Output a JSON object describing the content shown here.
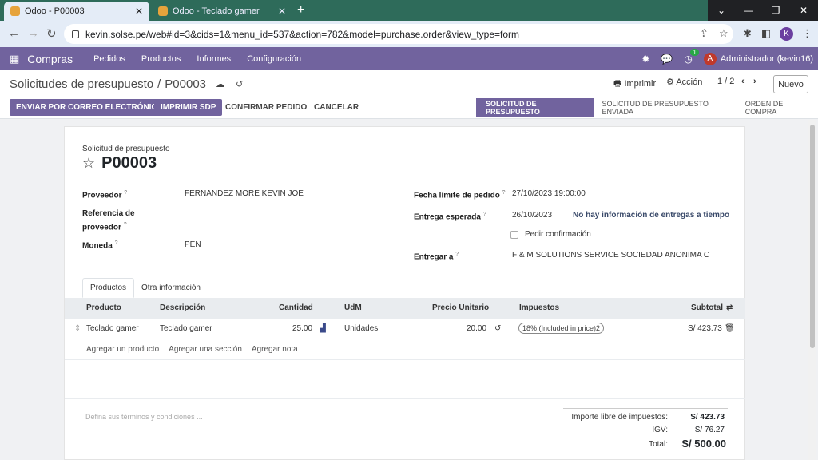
{
  "browser": {
    "tabs": [
      {
        "title": "Odoo - P00003",
        "active": true
      },
      {
        "title": "Odoo - Teclado gamer",
        "active": false
      }
    ],
    "url": "kevin.solse.pe/web#id=3&cids=1&menu_id=537&action=782&model=purchase.order&view_type=form",
    "profile_initial": "K"
  },
  "navbar": {
    "app_name": "Compras",
    "menus": [
      "Pedidos",
      "Productos",
      "Informes",
      "Configuración"
    ],
    "activity_count": "1",
    "user_initial": "A",
    "user_name": "Administrador (kevin16)"
  },
  "control_panel": {
    "breadcrumb_parent": "Solicitudes de presupuesto",
    "breadcrumb_sep": "/",
    "breadcrumb_current": "P00003",
    "print_label": "Imprimir",
    "action_label": "Acción",
    "pager": "1 / 2",
    "new_label": "Nuevo",
    "buttons": {
      "send_email": "ENVIAR POR CORREO ELECTRÓNICO",
      "print_rfq": "IMPRIMIR SDP",
      "confirm": "CONFIRMAR PEDIDO",
      "cancel": "CANCELAR"
    },
    "stages": [
      "SOLICITUD DE PRESUPUESTO",
      "SOLICITUD DE PRESUPUESTO ENVIADA",
      "ORDEN DE COMPRA"
    ]
  },
  "form": {
    "doc_label": "Solicitud de presupuesto",
    "name": "P00003",
    "fields": {
      "vendor_label": "Proveedor",
      "vendor": "FERNANDEZ MORE KEVIN JOE",
      "vendor_ref_label_1": "Referencia de",
      "vendor_ref_label_2": "proveedor",
      "currency_label": "Moneda",
      "currency": "PEN",
      "deadline_label": "Fecha límite de pedido",
      "deadline": "27/10/2023 19:00:00",
      "expected_label": "Entrega esperada",
      "expected": "26/10/2023",
      "expected_note": "No hay información de entregas a tiempo",
      "ask_confirm_label": "Pedir confirmación",
      "deliver_to_label": "Entregar a",
      "deliver_to": "F & M SOLUTIONS SERVICE SOCIEDAD ANONIMA CERR/"
    },
    "help_mark": "?",
    "notebook_tabs": [
      "Productos",
      "Otra información"
    ],
    "table": {
      "headers": {
        "product": "Producto",
        "description": "Descripción",
        "qty": "Cantidad",
        "uom": "UdM",
        "price": "Precio Unitario",
        "taxes": "Impuestos",
        "subtotal": "Subtotal"
      },
      "rows": [
        {
          "product": "Teclado gamer",
          "description": "Teclado gamer",
          "qty": "25.00",
          "uom": "Unidades",
          "price": "20.00",
          "tax": "18% (Included in price)2",
          "subtotal": "S/ 423.73"
        }
      ],
      "add_links": [
        "Agregar un producto",
        "Agregar una sección",
        "Agregar nota"
      ]
    },
    "terms_placeholder": "Defina sus términos y condiciones ...",
    "totals": {
      "untaxed_label": "Importe libre de impuestos:",
      "untaxed": "S/ 423.73",
      "tax_label": "IGV:",
      "tax": "S/ 76.27",
      "total_label": "Total:",
      "total": "S/ 500.00"
    }
  }
}
